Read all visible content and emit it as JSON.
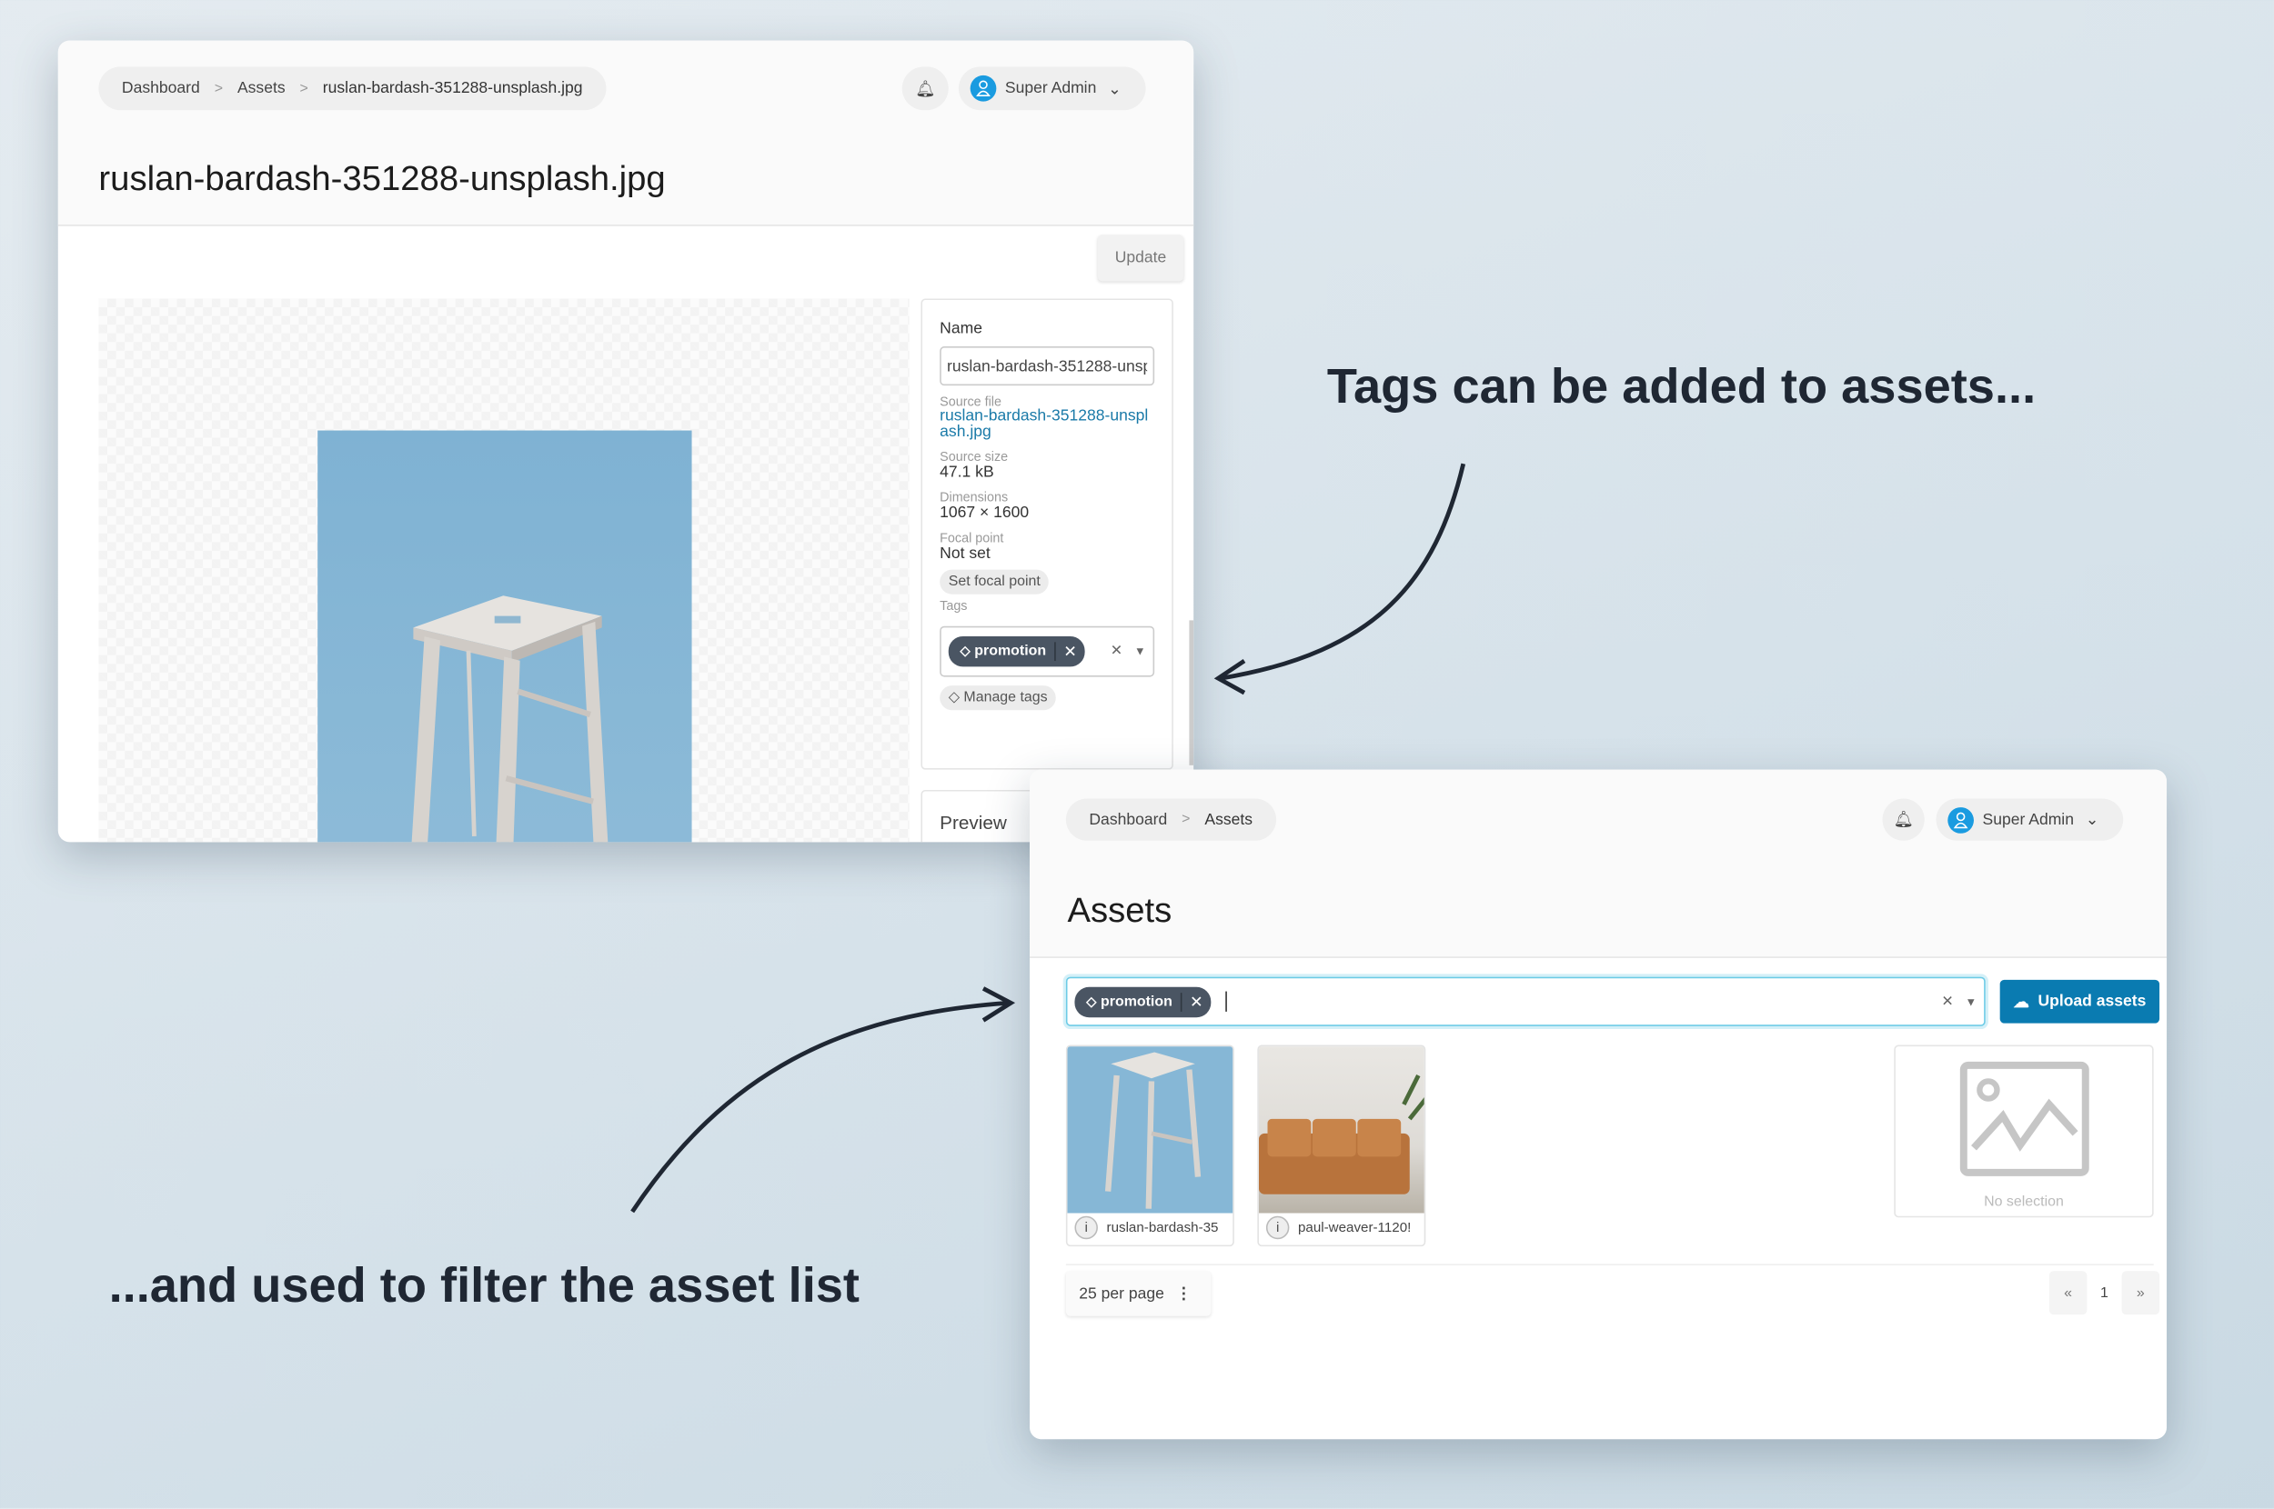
{
  "detail_window": {
    "breadcrumb": [
      "Dashboard",
      "Assets",
      "ruslan-bardash-351288-unsplash.jpg"
    ],
    "user": "Super Admin",
    "title": "ruslan-bardash-351288-unsplash.jpg",
    "update_label": "Update",
    "panel": {
      "name_label": "Name",
      "name_value": "ruslan-bardash-351288-unsplash.jpg",
      "source_file_label": "Source file",
      "source_file_value": "ruslan-bardash-351288-unsplash.jpg",
      "source_size_label": "Source size",
      "source_size_value": "47.1 kB",
      "dimensions_label": "Dimensions",
      "dimensions_value": "1067 × 1600",
      "focal_point_label": "Focal point",
      "focal_point_value": "Not set",
      "set_focal_point_label": "Set focal point",
      "tags_label": "Tags",
      "tags": [
        "promotion"
      ],
      "manage_tags_label": "Manage tags"
    },
    "preview_label": "Preview"
  },
  "list_window": {
    "breadcrumb": [
      "Dashboard",
      "Assets"
    ],
    "user": "Super Admin",
    "title": "Assets",
    "filter_tags": [
      "promotion"
    ],
    "upload_label": "Upload assets",
    "assets": [
      {
        "name": "ruslan-bardash-351288-unsplash.jpg",
        "display": "ruslan-bardash-35"
      },
      {
        "name": "paul-weaver-1120",
        "display": "paul-weaver-1120!"
      }
    ],
    "no_selection_label": "No selection",
    "per_page_label": "25 per page",
    "pagination": {
      "prev": "«",
      "current": "1",
      "next": "»"
    },
    "accent_color": "#0a7bb1"
  },
  "annotations": {
    "top": "Tags can be added to assets...",
    "bottom": "...and used to filter the asset list"
  }
}
